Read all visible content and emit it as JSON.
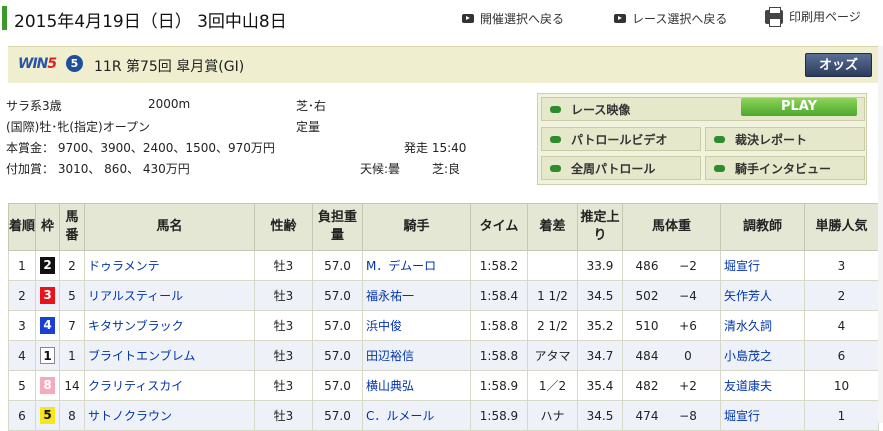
{
  "header": {
    "date": "2015年4月19日（日） 3回中山8日",
    "nav_meeting": "開催選択へ戻る",
    "nav_race": "レース選択へ戻る",
    "nav_print": "印刷用ページ"
  },
  "race": {
    "win5_label": "WIN",
    "win5_num": "5",
    "win5_leg": "5",
    "title": "11R 第75回 皐月賞(GI)",
    "odds_label": "オッズ",
    "category": "サラ系3歳",
    "distance": "2000m",
    "course": "芝･右",
    "conditions": "(国際)牡･牝(指定)オープン",
    "weight_rule": "定量",
    "prize": "本賞金： 9700、3900、2400、1500、970万円",
    "post_time": "発走 15:40",
    "bonus": "付加賞： 3010、 860、 430万円",
    "weather": "天候:曇",
    "going": "芝:良"
  },
  "media": {
    "replay": "レース映像",
    "play": "PLAY",
    "patrol": "パトロールビデオ",
    "inquiry": "裁決レポート",
    "full_patrol": "全周パトロール",
    "interview": "騎手インタビュー"
  },
  "colors": {
    "accent": "#3c9a2c",
    "header_bg": "#e4e7d3",
    "title_bg": "#efeecf",
    "link": "#0033aa"
  },
  "table": {
    "headers": {
      "rank": "着順",
      "waku": "枠",
      "num": "馬番",
      "horse": "馬名",
      "sexage": "性齢",
      "weight": "負担重量",
      "jockey": "騎手",
      "time": "タイム",
      "margin": "着差",
      "last3f": "推定上り",
      "bodyweight": "馬体重",
      "trainer": "調教師",
      "pop": "単勝人気"
    },
    "rows": [
      {
        "rank": "1",
        "waku": "2",
        "num": "2",
        "horse": "ドゥラメンテ",
        "sexage": "牡3",
        "weight": "57.0",
        "jockey": "M．デムーロ",
        "time": "1:58.2",
        "margin": "",
        "last3f": "33.9",
        "bw": "486",
        "bwd": "−2",
        "trainer": "堀宣行",
        "pop": "3"
      },
      {
        "rank": "2",
        "waku": "3",
        "num": "5",
        "horse": "リアルスティール",
        "sexage": "牡3",
        "weight": "57.0",
        "jockey": "福永祐一",
        "time": "1:58.4",
        "margin": "1 1/2",
        "last3f": "34.5",
        "bw": "502",
        "bwd": "−4",
        "trainer": "矢作芳人",
        "pop": "2"
      },
      {
        "rank": "3",
        "waku": "4",
        "num": "7",
        "horse": "キタサンブラック",
        "sexage": "牡3",
        "weight": "57.0",
        "jockey": "浜中俊",
        "time": "1:58.8",
        "margin": "2 1/2",
        "last3f": "35.2",
        "bw": "510",
        "bwd": "+6",
        "trainer": "清水久詞",
        "pop": "4"
      },
      {
        "rank": "4",
        "waku": "1",
        "num": "1",
        "horse": "ブライトエンブレム",
        "sexage": "牡3",
        "weight": "57.0",
        "jockey": "田辺裕信",
        "time": "1:58.8",
        "margin": "アタマ",
        "last3f": "34.7",
        "bw": "484",
        "bwd": "0",
        "trainer": "小島茂之",
        "pop": "6"
      },
      {
        "rank": "5",
        "waku": "8",
        "num": "14",
        "horse": "クラリティスカイ",
        "sexage": "牡3",
        "weight": "57.0",
        "jockey": "横山典弘",
        "time": "1:58.9",
        "margin": "1／2",
        "last3f": "35.4",
        "bw": "482",
        "bwd": "+2",
        "trainer": "友道康夫",
        "pop": "10"
      },
      {
        "rank": "6",
        "waku": "5",
        "num": "8",
        "horse": "サトノクラウン",
        "sexage": "牡3",
        "weight": "57.0",
        "jockey": "C．ルメール",
        "time": "1:58.9",
        "margin": "ハナ",
        "last3f": "34.5",
        "bw": "474",
        "bwd": "−8",
        "trainer": "堀宣行",
        "pop": "1"
      }
    ]
  }
}
